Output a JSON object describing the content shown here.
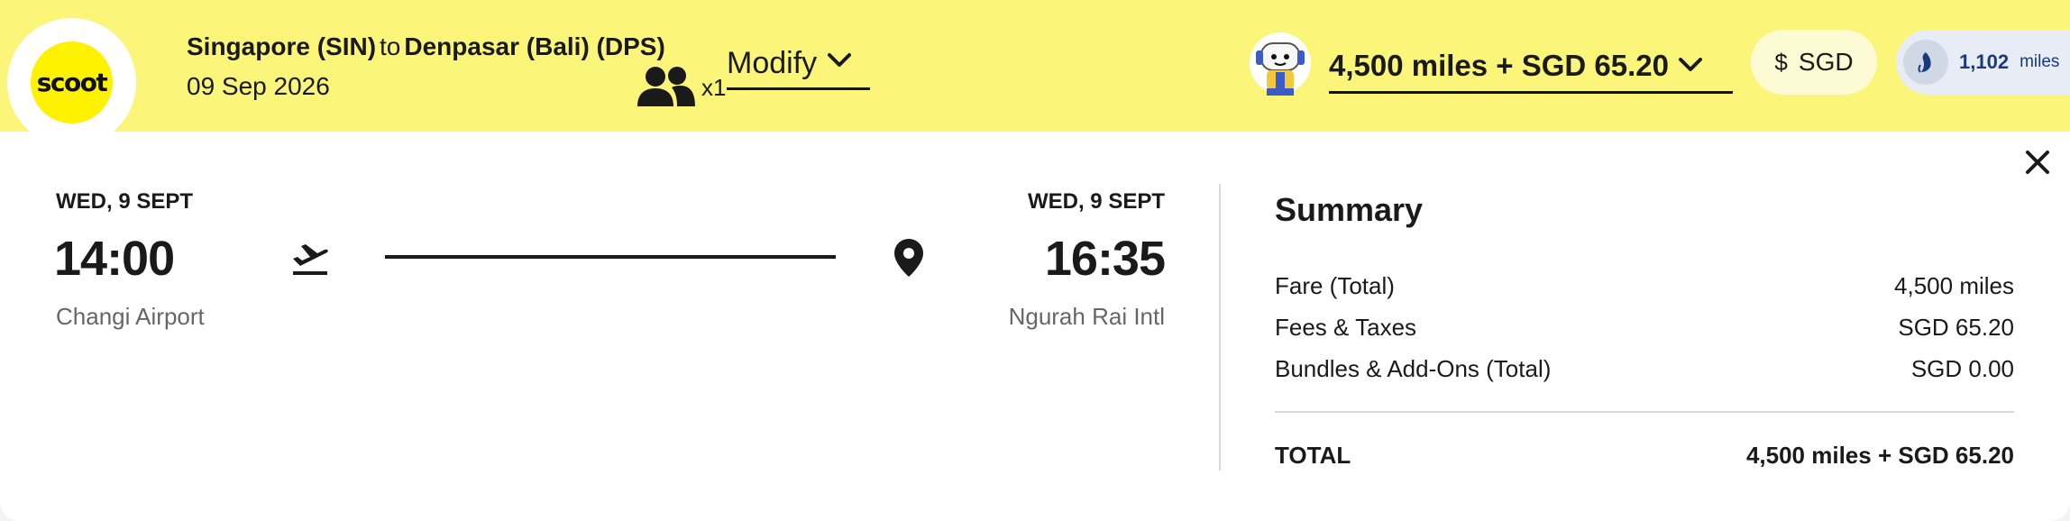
{
  "header": {
    "logo_text": "scoot",
    "origin": "Singapore (SIN)",
    "connector": "to",
    "destination": "Denpasar (Bali) (DPS)",
    "date": "09 Sep 2026",
    "pax_count": "x1",
    "modify_label": "Modify",
    "price_label": "4,500 miles + SGD 65.20",
    "currency_symbol": "$",
    "currency_code": "SGD",
    "krisflyer_miles": "1,102",
    "krisflyer_unit": "miles"
  },
  "flight": {
    "departure": {
      "day": "WED, 9 SEPT",
      "time": "14:00",
      "airport": "Changi Airport"
    },
    "arrival": {
      "day": "WED, 9 SEPT",
      "time": "16:35",
      "airport": "Ngurah Rai Intl"
    }
  },
  "summary": {
    "title": "Summary",
    "rows": [
      {
        "label": "Fare (Total)",
        "value": "4,500 miles"
      },
      {
        "label": "Fees & Taxes",
        "value": "SGD 65.20"
      },
      {
        "label": "Bundles & Add-Ons (Total)",
        "value": "SGD 0.00"
      }
    ],
    "total_label": "TOTAL",
    "total_value": "4,500 miles + SGD 65.20"
  },
  "icons": {
    "passengers": "people-icon",
    "chevron": "chevron-down-icon",
    "close": "close-icon",
    "takeoff": "airplane-takeoff-icon",
    "pin": "location-pin-icon",
    "mascot": "robot-mascot-icon",
    "krisflyer": "singapore-airlines-bird-icon"
  },
  "colors": {
    "header_bg": "#fbf57a",
    "logo_yellow": "#fff200",
    "currency_pill_bg": "#fdfbd3",
    "krisflyer_pill_bg": "#e8edf5",
    "krisflyer_text": "#1a3a7a"
  }
}
